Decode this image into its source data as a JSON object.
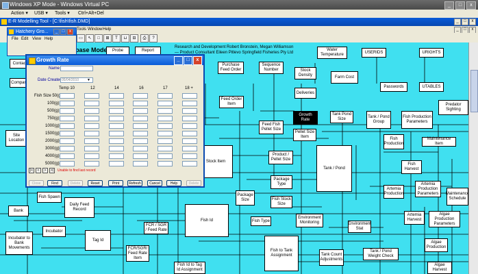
{
  "vpc": {
    "title": "Windows XP Mode - Windows Virtual PC",
    "menu": [
      "Action ▾",
      "USB ▾",
      "Tools ▾",
      "Ctrl+Alt+Del"
    ],
    "min": "_",
    "max": "□",
    "close": "x"
  },
  "app": {
    "title": "E-R Modelling Tool - [C:\\fish\\fish.DMD]",
    "menu": [
      "File",
      "Edit",
      "Format",
      "Tools",
      "Window",
      "Help"
    ],
    "min": "_",
    "max": "□",
    "close": "x"
  },
  "hatchery": {
    "title": "Hatchery Gro...",
    "menu": [
      "File",
      "Edit",
      "View",
      "Help"
    ]
  },
  "dialog": {
    "title": "Growth Rate",
    "name_label": "Name",
    "date_label": "Date Created",
    "date_value": "05/04/2010",
    "columns": [
      "Temp 10",
      "12",
      "14",
      "16",
      "17",
      "18 +"
    ],
    "size_header": "Fish Size 50(g)",
    "sizes": [
      "100(g)",
      "500(g)",
      "750(g)",
      "1000(g)",
      "1500(g)",
      "2000(g)",
      "3000(g)",
      "4000(g)",
      "5000(g)"
    ],
    "nav": [
      "|<",
      "<",
      ">",
      ">|"
    ],
    "status": "Unable to find last record",
    "buttons": [
      "Close",
      "Find",
      "Delete",
      "Reset",
      "Print",
      "Refresh",
      "Cancel",
      "Help",
      "Delete"
    ]
  },
  "diagram": {
    "header_lines": [
      "Research and Development Robert Bronstein, Megan Williamson",
      "— Product Consultant Eileen Pitlevo Springfield Fisheries Pty Ltd"
    ],
    "model_title": "base Model",
    "entities": [
      {
        "id": "probe",
        "label": "Probe"
      },
      {
        "id": "report",
        "label": "Report"
      },
      {
        "id": "water_temp",
        "label": "Water Temperature"
      },
      {
        "id": "userids",
        "label": "USERIDS"
      },
      {
        "id": "urights",
        "label": "URIGHTS"
      },
      {
        "id": "contact",
        "label": "Contact"
      },
      {
        "id": "company",
        "label": "Company"
      },
      {
        "id": "purchase_order",
        "label": "Purchase Feed Order"
      },
      {
        "id": "sequence_number",
        "label": "Sequence Number"
      },
      {
        "id": "stock_density",
        "label": "Stock Density"
      },
      {
        "id": "farm_cost",
        "label": "Farm Cost"
      },
      {
        "id": "deliveries",
        "label": "Deliveries"
      },
      {
        "id": "passwords",
        "label": "Passwords"
      },
      {
        "id": "utables",
        "label": "UTABLES"
      },
      {
        "id": "feed_order_item",
        "label": "Feed Order Item"
      },
      {
        "id": "growth_rate",
        "label": "Growth Rate"
      },
      {
        "id": "tank_pond_size",
        "label": "Tank Pond Size"
      },
      {
        "id": "tank_pond_group",
        "label": "Tank / Pond Group"
      },
      {
        "id": "predator_sighting",
        "label": "Predator Sighting"
      },
      {
        "id": "feed_fish_pellet_size",
        "label": "Feed Fish Pellet Size"
      },
      {
        "id": "pellet_size_item",
        "label": "Pellet Size Item"
      },
      {
        "id": "fish_production_params",
        "label": "Fish Production Parameters"
      },
      {
        "id": "site_location",
        "label": "Site Location"
      },
      {
        "id": "fish_production",
        "label": "Fish Production"
      },
      {
        "id": "maintenance_item",
        "label": "Maintenance Item"
      },
      {
        "id": "stock_item",
        "label": "Stock Item"
      },
      {
        "id": "product_pellet_size",
        "label": "Product / Pellet Size"
      },
      {
        "id": "tank_pond",
        "label": "Tank / Pond"
      },
      {
        "id": "fish_harvest",
        "label": "Fish Harvest"
      },
      {
        "id": "package_type",
        "label": "Package Type"
      },
      {
        "id": "artemia_production",
        "label": "Artemia Production"
      },
      {
        "id": "artemia_prod_params",
        "label": "Artemia Production Parameters"
      },
      {
        "id": "fish_spawn",
        "label": "Fish Spawn"
      },
      {
        "id": "daily_feed_record",
        "label": "Daily Feed Record"
      },
      {
        "id": "package_size",
        "label": "Package Size"
      },
      {
        "id": "fish_stock_size",
        "label": "Fish Stock Size"
      },
      {
        "id": "maintenance_schedule",
        "label": "Maintenance Schedule"
      },
      {
        "id": "bank",
        "label": "Bank"
      },
      {
        "id": "fish_id",
        "label": "Fish Id"
      },
      {
        "id": "fish_type",
        "label": "Fish Type"
      },
      {
        "id": "environment_monitoring",
        "label": "Environment Monitoring"
      },
      {
        "id": "environment_stat",
        "label": "Environment Stat"
      },
      {
        "id": "artemia_harvest",
        "label": "Artemia Harvest"
      },
      {
        "id": "algae_prod_params",
        "label": "Algae Production Parameters"
      },
      {
        "id": "incubator",
        "label": "Incubator"
      },
      {
        "id": "fcr_feed_rate",
        "label": "FCR / SGR / Feed Rate"
      },
      {
        "id": "tag_id",
        "label": "Tag Id"
      },
      {
        "id": "incubator_bank_movements",
        "label": "Incubator to Bank Movements"
      },
      {
        "id": "fcr_sgr_feed_rate_item",
        "label": "FCR/SGR/ Feed Rate Item"
      },
      {
        "id": "fish_to_tank_assignment",
        "label": "Fish to Tank Assignment"
      },
      {
        "id": "tank_count_adjustments",
        "label": "Tank Count Adjustments"
      },
      {
        "id": "tank_pond_weight_check",
        "label": "Tank / Pond Weight Check"
      },
      {
        "id": "algae_production",
        "label": "Algae Production"
      },
      {
        "id": "tag_id_to_fish_id_assignment",
        "label": "Fish Id to Tag Id Assignment"
      },
      {
        "id": "algae_harvest",
        "label": "Algae Harvest"
      }
    ]
  }
}
